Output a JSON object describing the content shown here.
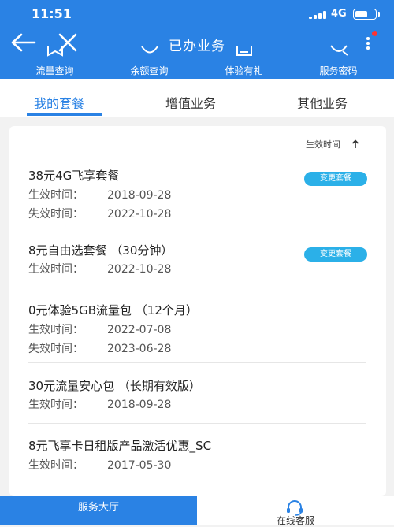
{
  "status_bar": {
    "time": "11:51",
    "network": "4G"
  },
  "nav": {
    "title": "已办业务"
  },
  "quick_links": [
    {
      "label": "流量查询",
      "icon": "data-usage-icon"
    },
    {
      "label": "余额查询",
      "icon": "balance-icon"
    },
    {
      "label": "体验有礼",
      "icon": "gift-icon"
    },
    {
      "label": "服务密码",
      "icon": "password-icon"
    }
  ],
  "tabs": [
    {
      "label": "我的套餐",
      "active": true
    },
    {
      "label": "增值业务",
      "active": false
    },
    {
      "label": "其他业务",
      "active": false
    }
  ],
  "sort": {
    "label": "生效时间"
  },
  "field_labels": {
    "effective": "生效时间：",
    "expire": "失效时间："
  },
  "change_button_label": "变更套餐",
  "packages": [
    {
      "name": "38元4G飞享套餐",
      "effective": "2018-09-28",
      "expire": "2022-10-28",
      "has_change": true
    },
    {
      "name": "8元自由选套餐 （30分钟）",
      "effective": "2022-10-28",
      "has_change": true
    },
    {
      "name": "0元体验5GB流量包 （12个月）",
      "effective": "2022-07-08",
      "expire": "2023-06-28",
      "has_change": false
    },
    {
      "name": "30元流量安心包 （长期有效版）",
      "effective": "2018-09-28",
      "has_change": false
    },
    {
      "name": "8元飞享卡日租版产品激活优惠_SC",
      "effective": "2017-05-30",
      "has_change": false
    }
  ],
  "bottom_nav": {
    "left": "服务大厅",
    "right": "在线客服"
  },
  "colors": {
    "primary": "#2a82e4",
    "button": "#2bb0e8",
    "notification": "#ff3333"
  }
}
